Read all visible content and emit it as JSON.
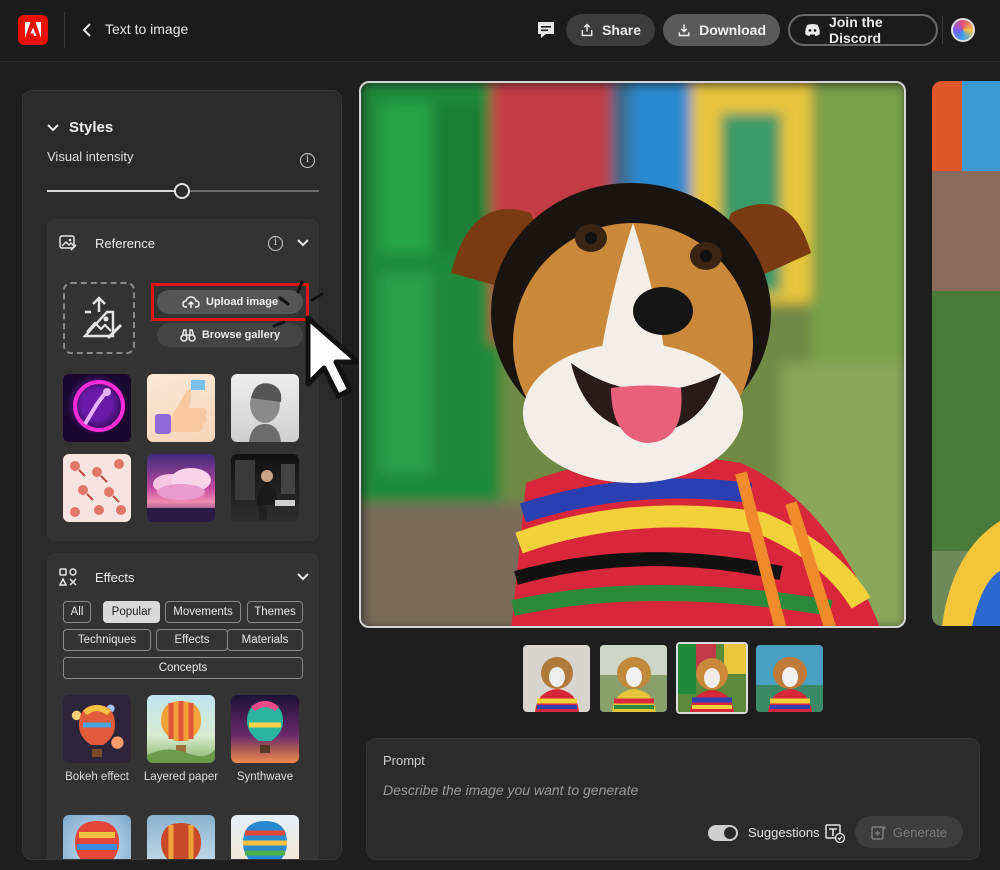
{
  "header": {
    "title": "Text to image",
    "share_label": "Share",
    "download_label": "Download",
    "discord_label": "Join the Discord"
  },
  "styles": {
    "section_label": "Styles",
    "visual_intensity_label": "Visual intensity",
    "visual_intensity_value": 0.5
  },
  "reference": {
    "label": "Reference",
    "upload_label": "Upload image",
    "browse_label": "Browse gallery"
  },
  "effects": {
    "label": "Effects",
    "chips": [
      "All",
      "Popular",
      "Movements",
      "Themes",
      "Techniques",
      "Effects",
      "Materials",
      "Concepts"
    ],
    "active_chip": "Popular",
    "items": [
      "Bokeh effect",
      "Layered paper",
      "Synthwave"
    ]
  },
  "prompt": {
    "label": "Prompt",
    "placeholder": "Describe the image you want to generate",
    "suggestions_label": "Suggestions",
    "suggestions_on": true,
    "generate_label": "Generate"
  },
  "colors": {
    "brand": "#eb1000",
    "highlight": "#e01515"
  }
}
